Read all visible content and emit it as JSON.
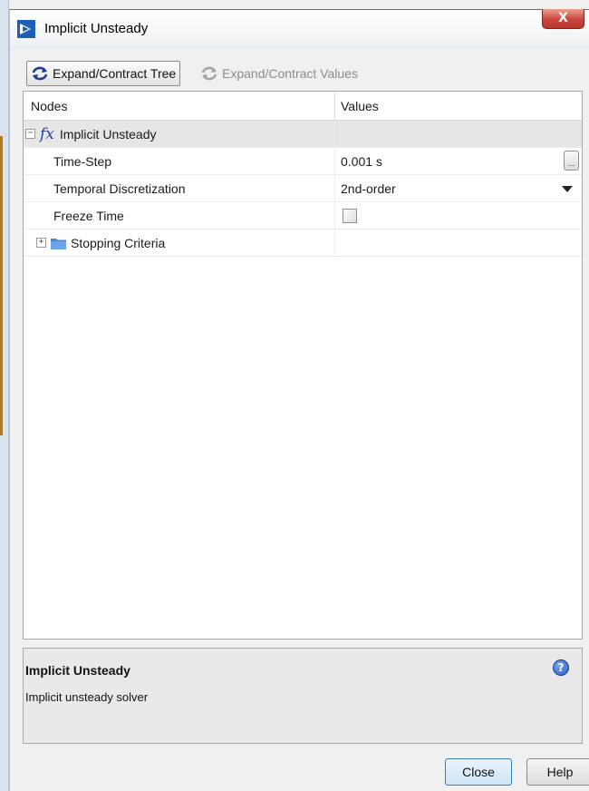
{
  "window": {
    "title": "Implicit Unsteady",
    "close_glyph": "X"
  },
  "toolbar": {
    "expand_tree_label": "Expand/Contract Tree",
    "expand_values_label": "Expand/Contract Values",
    "icon": "refresh-arrows-icon"
  },
  "tree": {
    "headers": {
      "nodes": "Nodes",
      "values": "Values"
    },
    "root": {
      "label": "Implicit Unsteady",
      "icon": "fx-icon",
      "expanded": true,
      "expander": "−"
    },
    "rows": [
      {
        "label": "Time-Step",
        "value": "0.001 s",
        "editor": "ellipsis",
        "ellipsis": "..."
      },
      {
        "label": "Temporal Discretization",
        "value": "2nd-order",
        "editor": "dropdown"
      },
      {
        "label": "Freeze Time",
        "value": "",
        "editor": "checkbox",
        "checked": false
      },
      {
        "label": "Stopping Criteria",
        "icon": "folder-icon",
        "expanded": false,
        "expander": "+"
      }
    ]
  },
  "description": {
    "title": "Implicit Unsteady",
    "text": "Implicit unsteady solver",
    "help_glyph": "?"
  },
  "buttons": {
    "close": "Close",
    "help": "Help"
  },
  "colors": {
    "accent_blue": "#2a5cc2",
    "fx_blue": "#2a3f9e",
    "folder_blue": "#4a86d8",
    "close_red": "#c9453a"
  }
}
